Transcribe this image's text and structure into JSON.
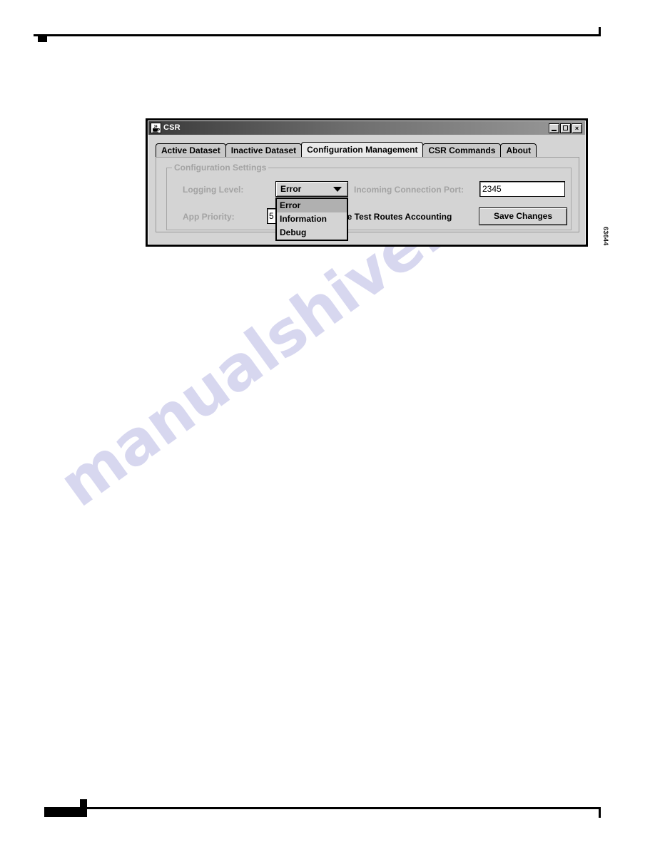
{
  "page": {
    "figure_number": "63644",
    "watermark": "manualshive.com"
  },
  "window": {
    "title": "CSR",
    "icon": "java-coffee-cup-icon",
    "controls": {
      "minimize": "_",
      "maximize": "□",
      "close": "×"
    }
  },
  "tabs": [
    {
      "label": "Active Dataset",
      "selected": false
    },
    {
      "label": "Inactive Dataset",
      "selected": false
    },
    {
      "label": "Configuration Management",
      "selected": true
    },
    {
      "label": "CSR Commands",
      "selected": false
    },
    {
      "label": "About",
      "selected": false
    }
  ],
  "group": {
    "title": "Configuration Settings"
  },
  "form": {
    "logging_level": {
      "label": "Logging Level:",
      "value": "Error",
      "expanded": true,
      "options": [
        {
          "label": "Error",
          "highlighted": true
        },
        {
          "label": "Information",
          "highlighted": false
        },
        {
          "label": "Debug",
          "highlighted": false
        }
      ]
    },
    "incoming_connection_port": {
      "label": "Incoming Connection Port:",
      "value": "2345",
      "placeholder": ""
    },
    "app_priority": {
      "label": "App Priority:",
      "value": "5",
      "placeholder": ""
    },
    "test_routes_accounting": {
      "label": "ble Test Routes Accounting",
      "full_label": "Enable Test Routes Accounting",
      "checked": false
    },
    "save_changes": {
      "label": "Save Changes"
    }
  },
  "colors": {
    "window_face": "#d4d4d4",
    "tab_selected": "#eaeaea",
    "tab_unselected": "#c9c9c9",
    "disabled_label": "#a3a3a3",
    "popup_highlight": "#b0b0b0",
    "watermark": "#c9c9ea"
  }
}
